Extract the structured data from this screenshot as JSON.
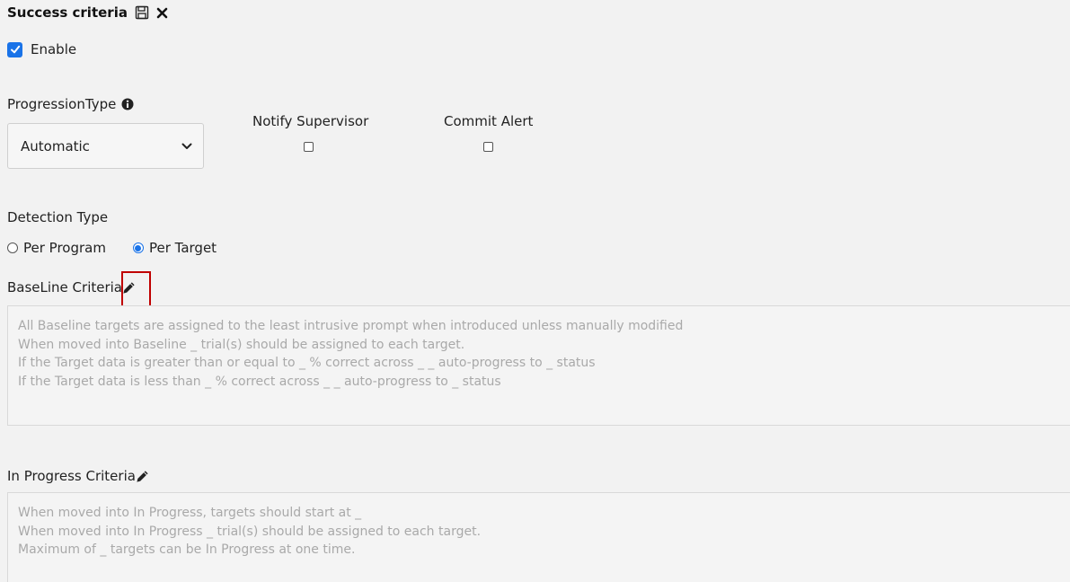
{
  "header": {
    "title": "Success criteria",
    "save_icon": "save-icon",
    "close_icon": "close-icon"
  },
  "enable": {
    "label": "Enable",
    "checked": true
  },
  "progression": {
    "label": "ProgressionType",
    "info_icon": "info-icon",
    "selected": "Automatic"
  },
  "notify_supervisor": {
    "label": "Notify Supervisor",
    "checked": false
  },
  "commit_alert": {
    "label": "Commit Alert",
    "checked": false
  },
  "detection": {
    "label": "Detection Type",
    "options": [
      "Per Program",
      "Per Target"
    ],
    "selected": "Per Target"
  },
  "baseline": {
    "label": "BaseLine Criteria",
    "lines": [
      "All Baseline targets are assigned to the least intrusive prompt when introduced unless manually modified",
      "When moved into Baseline _ trial(s) should be assigned to each target.",
      "If the Target data is greater than or equal to _ % correct across _ _ auto-progress to _ status",
      "If the Target data is less than _ % correct across _ _ auto-progress to _ status"
    ]
  },
  "in_progress": {
    "label": "In Progress Criteria",
    "lines": [
      "When moved into In Progress, targets should start at _",
      "When moved into In Progress _ trial(s) should be assigned to each target.",
      "Maximum of _ targets can be In Progress at one time."
    ]
  },
  "colors": {
    "accent": "#1a73e8",
    "highlight": "#c00000",
    "background": "#f2f2f2"
  }
}
